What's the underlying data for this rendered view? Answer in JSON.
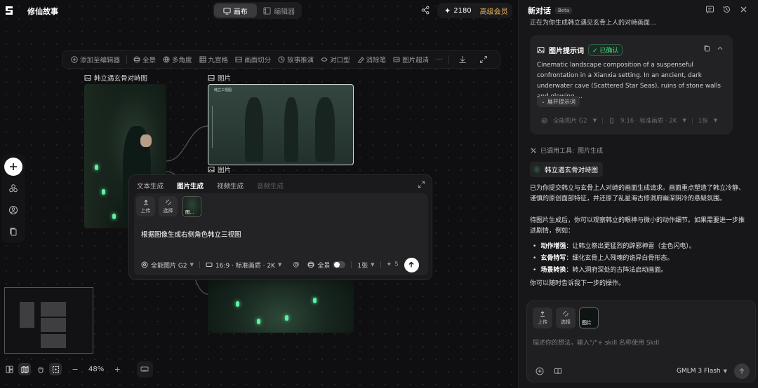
{
  "app": {
    "project_title": "修仙故事",
    "view_tabs": [
      {
        "label": "画布",
        "active": true
      },
      {
        "label": "编辑器",
        "active": false
      }
    ],
    "credits": "2180",
    "vip_label": "高级会员"
  },
  "toolbar": {
    "items": [
      "添加至编辑器",
      "全景",
      "多角度",
      "九宫格",
      "画面切分",
      "故事推演",
      "对口型",
      "消除笔",
      "图片超清"
    ],
    "more": "···"
  },
  "nodes": {
    "main_label": "韩立遇玄骨对峙图",
    "sheet_label": "图片",
    "cave_label": "图片",
    "sheet_caption": "韩立三视图"
  },
  "generator": {
    "tabs": [
      "文本生成",
      "图片生成",
      "视频生成",
      "音频生成"
    ],
    "upload_label": "上传",
    "select_label": "选择",
    "thumb_label": "图...",
    "prompt": "根据图像生成右侧角色韩立三视图",
    "model": "全能图片 G2",
    "ratio_quality": "16:9 · 标准画质 · 2K",
    "at": "@",
    "panorama_label": "全景",
    "count": "1张",
    "cost": "5"
  },
  "bottom": {
    "zoom": "48%",
    "minus": "−",
    "plus": "+"
  },
  "chat": {
    "title": "新对话",
    "beta": "Beta",
    "cut_text": "正在为你生成韩立遇见玄骨上人的对峙画面...",
    "prompt_card": {
      "title": "图片提示词",
      "status": "已确认",
      "body": "Cinematic landscape composition of a suspenseful confrontation in a Xianxia setting. In an ancient, dark underwater cave (Scattered Star Seas), ruins of stone walls and glowing ...",
      "expand": "展开提示词",
      "model": "全能图片 G2",
      "ratio": "9:16 · 标准画质 · 2K",
      "count": "1张"
    },
    "tool_used_prefix": "已调用工具:",
    "tool_used_name": "图片生成",
    "ref_chip": "韩立遇玄骨对峙图",
    "paragraph1": "已为你提交韩立与玄骨上人对峙的画面生成请求。画面重点塑造了韩立冷静、谨慎的原创面部特征，并还原了乱星海古修洞府幽深阴冷的悬疑氛围。",
    "paragraph2": "待图片生成后，你可以观察韩立的眼神与微小的动作细节。如果需要进一步推进剧情，例如：",
    "bullets": [
      {
        "bold": "动作增强",
        "text": "：让韩立祭出更猛烈的辟邪神雷（金色闪电）。"
      },
      {
        "bold": "玄骨特写",
        "text": "：细化玄骨上人残魂的诡异白骨形态。"
      },
      {
        "bold": "场景转换",
        "text": "：转入洞府深处的古阵法启动画面。"
      }
    ],
    "paragraph3": "你可以随时告诉我下一步的操作。",
    "input": {
      "upload_label": "上传",
      "select_label": "选择",
      "image_label": "图片",
      "placeholder": "描述你的想法，输入\"/\"+ skill 名称使用 Skill",
      "model": "GMLM 3 Flash"
    }
  },
  "colors": {
    "accent_gold": "#e8b25a",
    "confirmed_green": "#52d48a",
    "glow_green": "#5df2a4"
  }
}
